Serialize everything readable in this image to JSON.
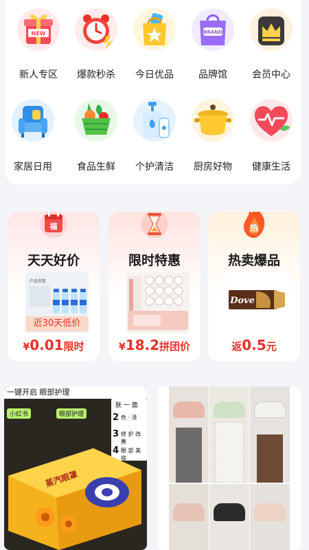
{
  "categories": [
    {
      "label": "新人专区",
      "icon": "new-gift-icon",
      "badge": "NEW"
    },
    {
      "label": "爆款秒杀",
      "icon": "alarm-clock-icon"
    },
    {
      "label": "今日优品",
      "icon": "star-shopping-bag-icon"
    },
    {
      "label": "品牌馆",
      "icon": "brand-bag-icon",
      "badge": "BRAND"
    },
    {
      "label": "会员中心",
      "icon": "crown-icon"
    },
    {
      "label": "家居日用",
      "icon": "armchair-icon"
    },
    {
      "label": "食品生鲜",
      "icon": "vegetable-basket-icon"
    },
    {
      "label": "个护清洁",
      "icon": "lotion-bottle-icon"
    },
    {
      "label": "厨房好物",
      "icon": "cooking-pot-icon"
    },
    {
      "label": "健康生活",
      "icon": "heart-pulse-icon"
    }
  ],
  "promos": [
    {
      "title": "天天好价",
      "icon": "calendar-icon",
      "icon_glyph": "福",
      "tag": "近30天低价",
      "sheet_title": "产品参数",
      "currency": "¥",
      "price": "0.01",
      "suffix": "限时"
    },
    {
      "title": "限时特惠",
      "icon": "hourglass-icon",
      "currency": "¥",
      "price": "18.2",
      "suffix": "拼团价"
    },
    {
      "title": "热卖爆品",
      "icon": "flame-icon",
      "icon_glyph": "热",
      "product_text": "Dove",
      "prefix": "返",
      "price": "0.5",
      "suffix": "元"
    }
  ],
  "feed": [
    {
      "banner": "一键开启 眼部护理",
      "bubbles": [
        "小红书",
        "眼部护理"
      ],
      "steps": [
        "肤 一 面",
        "色 · 泽",
        "修 护 改 善",
        "眼 部 美 容"
      ],
      "step_numbers": [
        "2",
        "3",
        "4"
      ],
      "box_text": "蒸汽眼罩"
    },
    {
      "product": "bras-grid-image"
    }
  ],
  "colors": {
    "price_red": "#e8302a",
    "page_bg": "#f4f5f8"
  }
}
